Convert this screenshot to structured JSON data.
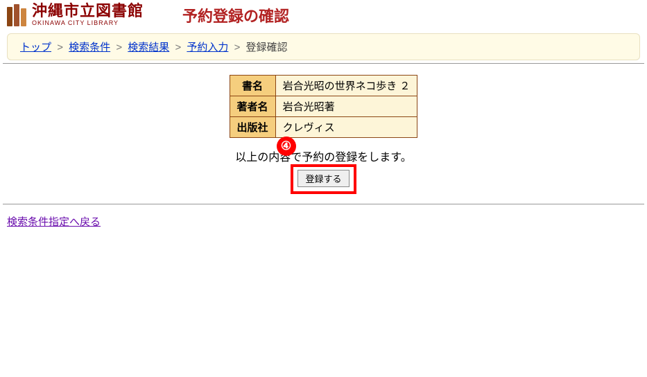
{
  "header": {
    "library_name_jp": "沖縄市立図書館",
    "library_name_en": "OKINAWA CITY LIBRARY",
    "page_title": "予約登録の確認"
  },
  "breadcrumb": {
    "items": [
      "トップ",
      "検索条件",
      "検索結果",
      "予約入力"
    ],
    "current": "登録確認",
    "sep": ">"
  },
  "table": {
    "rows": [
      {
        "label": "書名",
        "value": "岩合光昭の世界ネコ歩き ２"
      },
      {
        "label": "著者名",
        "value": "岩合光昭著"
      },
      {
        "label": "出版社",
        "value": "クレヴィス"
      }
    ]
  },
  "confirm_text": "以上の内容で予約の登録をします。",
  "submit_label": "登録する",
  "badge_text": "④",
  "back_link": "検索条件指定へ戻る"
}
